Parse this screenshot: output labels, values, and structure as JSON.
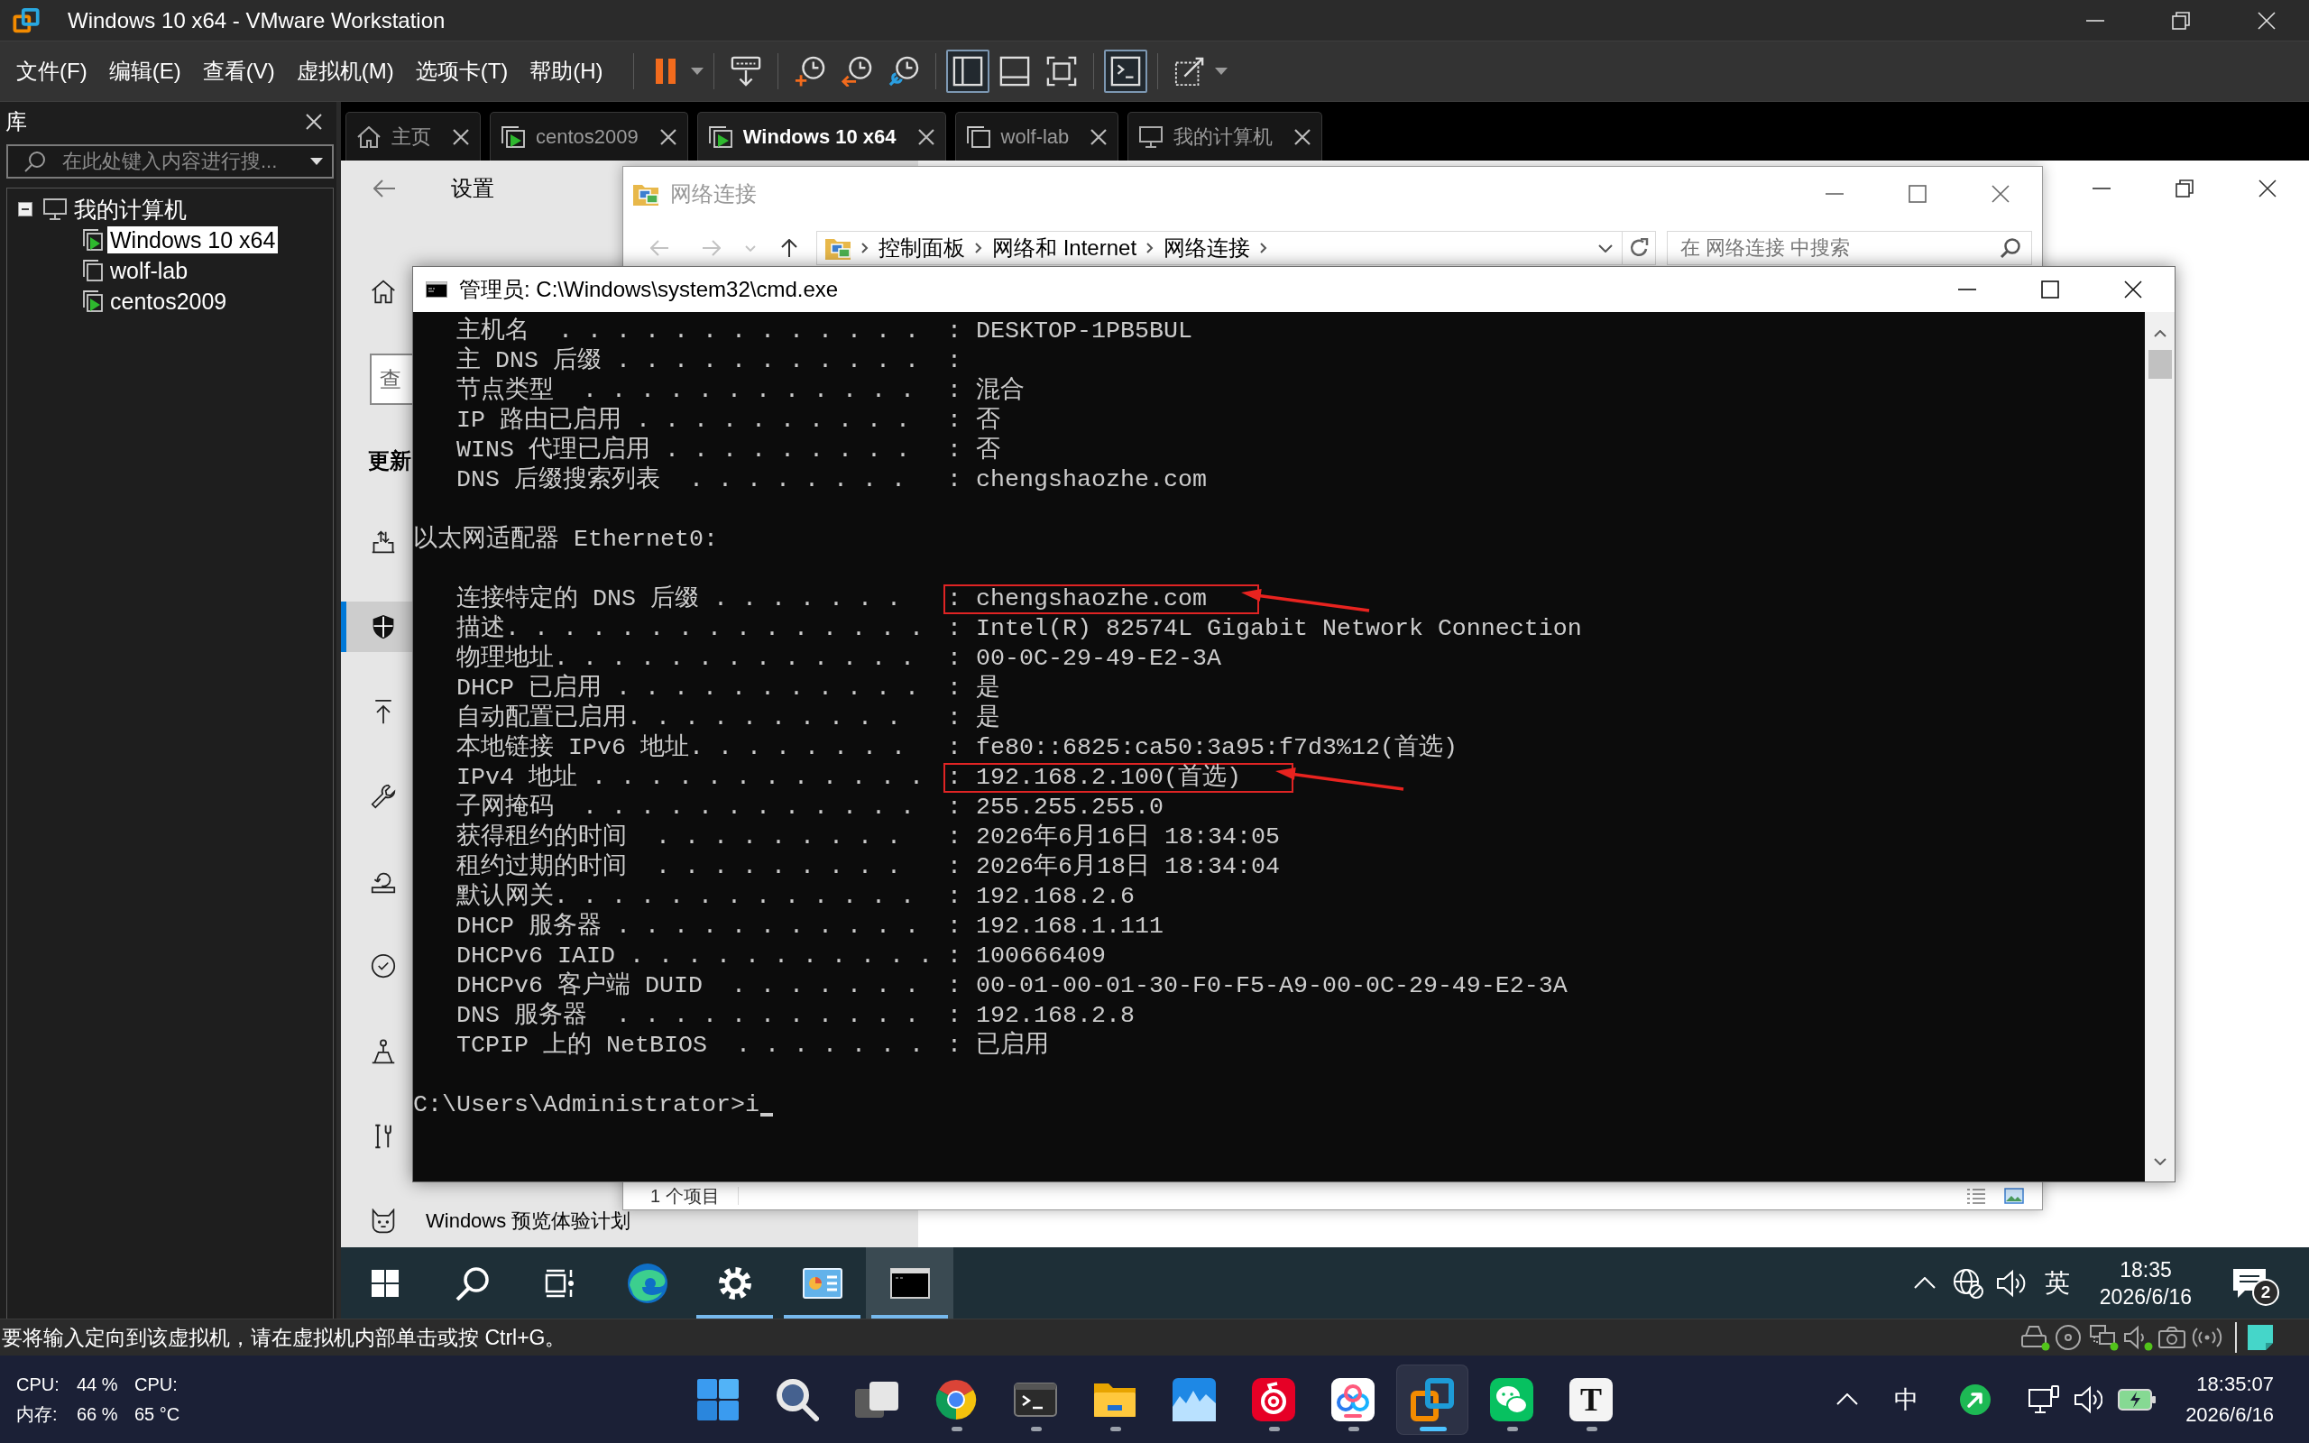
{
  "window": {
    "title": "Windows 10 x64 - VMware Workstation"
  },
  "menu": [
    "文件(F)",
    "编辑(E)",
    "查看(V)",
    "虚拟机(M)",
    "选项卡(T)",
    "帮助(H)"
  ],
  "toolbar": [
    {
      "kind": "pause",
      "pressed": false
    },
    {
      "kind": "keys",
      "pressed": false
    },
    {
      "kind": "snapshot",
      "pressed": false
    },
    {
      "kind": "revert",
      "pressed": false
    },
    {
      "kind": "manager",
      "pressed": false
    },
    {
      "kind": "library",
      "pressed": true
    },
    {
      "kind": "thumbnails",
      "pressed": false
    },
    {
      "kind": "fullscreen",
      "pressed": false
    },
    {
      "kind": "console",
      "pressed": true
    },
    {
      "kind": "stretch",
      "pressed": false
    }
  ],
  "library": {
    "title": "库",
    "search": {
      "placeholder": "在此处键入内容进行搜..."
    },
    "tree": [
      {
        "label": "我的计算机",
        "expanded": true,
        "selected": false,
        "children": [
          {
            "label": "Windows 10 x64",
            "selected": true,
            "running": true
          },
          {
            "label": "wolf-lab",
            "selected": false,
            "running": false
          },
          {
            "label": "centos2009",
            "selected": false,
            "running": true
          }
        ]
      }
    ]
  },
  "tabs": [
    {
      "kind": "home",
      "label": "主页",
      "selected": false
    },
    {
      "kind": "vm",
      "label": "centos2009",
      "selected": false,
      "running": true
    },
    {
      "kind": "vm",
      "label": "Windows 10 x64",
      "selected": true,
      "running": true
    },
    {
      "kind": "vm",
      "label": "wolf-lab",
      "selected": false,
      "running": false
    },
    {
      "kind": "computer",
      "label": "我的计算机",
      "selected": false
    }
  ],
  "settings": {
    "title": "设置",
    "search": {
      "placeholder": "查"
    },
    "section": "更新",
    "nav": [
      {
        "kind": "delivery",
        "selected": false
      },
      {
        "kind": "security",
        "selected": true
      },
      {
        "kind": "backup",
        "selected": false
      },
      {
        "kind": "troubleshoot",
        "selected": false
      },
      {
        "kind": "recovery",
        "selected": false
      },
      {
        "kind": "activation",
        "selected": false
      },
      {
        "kind": "finddevice",
        "selected": false
      },
      {
        "kind": "developer",
        "selected": false
      },
      {
        "kind": "insider",
        "selected": false,
        "label": "Windows 预览体验计划"
      }
    ]
  },
  "explorer": {
    "title": "网络连接",
    "nav": [
      {
        "kind": "back",
        "disabled": true
      },
      {
        "kind": "forward",
        "disabled": true
      },
      {
        "kind": "recent",
        "disabled": true
      },
      {
        "kind": "up",
        "disabled": false
      }
    ],
    "breadcrumb": [
      "控制面板",
      "网络和 Internet",
      "网络连接"
    ],
    "search": {
      "placeholder": "在 网络连接 中搜索"
    },
    "status": "1 个项目"
  },
  "cmd": {
    "title": "管理员: C:\\Windows\\system32\\cmd.exe",
    "lines": [
      {
        "kind": "field",
        "label": "主机名  . . . . . . . . . . . . .",
        "value": ": DESKTOP-1PB5BUL",
        "highlighted": false
      },
      {
        "kind": "field",
        "label": "主 DNS 后缀 . . . . . . . . . . .",
        "value": ":",
        "highlighted": false
      },
      {
        "kind": "field",
        "label": "节点类型  . . . . . . . . . . . .",
        "value": ": 混合",
        "highlighted": false
      },
      {
        "kind": "field",
        "label": "IP 路由已启用 . . . . . . . . . .",
        "value": ": 否",
        "highlighted": false
      },
      {
        "kind": "field",
        "label": "WINS 代理已启用 . . . . . . . . .",
        "value": ": 否",
        "highlighted": false
      },
      {
        "kind": "field",
        "label": "DNS 后缀搜索列表  . . . . . . . .",
        "value": ": chengshaozhe.com",
        "highlighted": false
      },
      {
        "kind": "heading",
        "text": "以太网适配器 Ethernet0:",
        "highlighted": false
      },
      {
        "kind": "field",
        "label": "连接特定的 DNS 后缀 . . . . . . .",
        "value": ": chengshaozhe.com",
        "highlighted": true
      },
      {
        "kind": "field",
        "label": "描述. . . . . . . . . . . . . . .",
        "value": ": Intel(R) 82574L Gigabit Network Connection",
        "highlighted": false
      },
      {
        "kind": "field",
        "label": "物理地址. . . . . . . . . . . . .",
        "value": ": 00-0C-29-49-E2-3A",
        "highlighted": false
      },
      {
        "kind": "field",
        "label": "DHCP 已启用 . . . . . . . . . . .",
        "value": ": 是",
        "highlighted": false
      },
      {
        "kind": "field",
        "label": "自动配置已启用. . . . . . . . . .",
        "value": ": 是",
        "highlighted": false
      },
      {
        "kind": "field",
        "label": "本地链接 IPv6 地址. . . . . . . .",
        "value": ": fe80::6825:ca50:3a95:f7d3%12(首选)",
        "highlighted": false
      },
      {
        "kind": "field",
        "label": "IPv4 地址 . . . . . . . . . . . .",
        "value": ": 192.168.2.100(首选)",
        "highlighted": true
      },
      {
        "kind": "field",
        "label": "子网掩码  . . . . . . . . . . . .",
        "value": ": 255.255.255.0",
        "highlighted": false
      },
      {
        "kind": "field",
        "label": "获得租约的时间  . . . . . . . . .",
        "value": ": 2026年6月16日 18:34:05",
        "highlighted": false
      },
      {
        "kind": "field",
        "label": "租约过期的时间  . . . . . . . . .",
        "value": ": 2026年6月18日 18:34:04",
        "highlighted": false
      },
      {
        "kind": "field",
        "label": "默认网关. . . . . . . . . . . . .",
        "value": ": 192.168.2.6",
        "highlighted": false
      },
      {
        "kind": "field",
        "label": "DHCP 服务器 . . . . . . . . . . .",
        "value": ": 192.168.1.111",
        "highlighted": false
      },
      {
        "kind": "field",
        "label": "DHCPv6 IAID . . . . . . . . . . .",
        "value": ": 100666409",
        "highlighted": false
      },
      {
        "kind": "field",
        "label": "DHCPv6 客户端 DUID  . . . . . . .",
        "value": ": 00-01-00-01-30-F0-F5-A9-00-0C-29-49-E2-3A",
        "highlighted": false
      },
      {
        "kind": "field",
        "label": "DNS 服务器  . . . . . . . . . . .",
        "value": ": 192.168.2.8",
        "highlighted": false
      },
      {
        "kind": "field",
        "label": "TCPIP 上的 NetBIOS  . . . . . . .",
        "value": ": 已启用",
        "highlighted": false
      },
      {
        "kind": "prompt",
        "text": "C:\\Users\\Administrator>i",
        "highlighted": false
      }
    ]
  },
  "guest_taskbar": {
    "items": [
      {
        "kind": "start",
        "running": false,
        "selected": false
      },
      {
        "kind": "search",
        "running": false,
        "selected": false
      },
      {
        "kind": "taskview",
        "running": false,
        "selected": false
      },
      {
        "kind": "edge",
        "running": false,
        "selected": false
      },
      {
        "kind": "settings",
        "running": true,
        "selected": false
      },
      {
        "kind": "controlpanel",
        "running": true,
        "selected": false
      },
      {
        "kind": "console",
        "running": true,
        "selected": true
      }
    ],
    "tray": {
      "ime": "英",
      "time": "18:35",
      "date": "2026/6/16",
      "notifications": "2"
    }
  },
  "status_bar": {
    "message": "要将输入定向到该虚拟机，请在虚拟机内部单击或按 Ctrl+G。",
    "devices": [
      {
        "kind": "disk",
        "connected": true
      },
      {
        "kind": "cd",
        "connected": false
      },
      {
        "kind": "network",
        "connected": true
      },
      {
        "kind": "sound",
        "connected": true
      },
      {
        "kind": "camera",
        "connected": false
      },
      {
        "kind": "wireless",
        "connected": false
      }
    ]
  },
  "host_taskbar": {
    "monitor": {
      "usage": [
        {
          "label": "CPU:",
          "value": "44 %"
        },
        {
          "label": "内存:",
          "value": "66 %"
        }
      ],
      "temperature": {
        "label": "CPU:",
        "value": "65 °C"
      }
    },
    "apps": [
      {
        "kind": "start",
        "running": false,
        "selected": false
      },
      {
        "kind": "search",
        "running": false,
        "selected": false
      },
      {
        "kind": "taskview",
        "running": false,
        "selected": false
      },
      {
        "kind": "chrome",
        "running": true,
        "selected": false
      },
      {
        "kind": "terminal",
        "running": true,
        "selected": false
      },
      {
        "kind": "explorer",
        "running": true,
        "selected": false
      },
      {
        "kind": "stocks",
        "running": false,
        "selected": false
      },
      {
        "kind": "music",
        "running": true,
        "selected": false
      },
      {
        "kind": "netdisk",
        "running": true,
        "selected": false
      },
      {
        "kind": "vmware",
        "running": true,
        "selected": true
      },
      {
        "kind": "wechat",
        "running": true,
        "selected": false
      },
      {
        "kind": "typora",
        "running": true,
        "selected": false,
        "glyph": "T"
      }
    ],
    "tray": {
      "ime": "中",
      "time": "18:35:07",
      "date": "2026/6/16"
    }
  }
}
